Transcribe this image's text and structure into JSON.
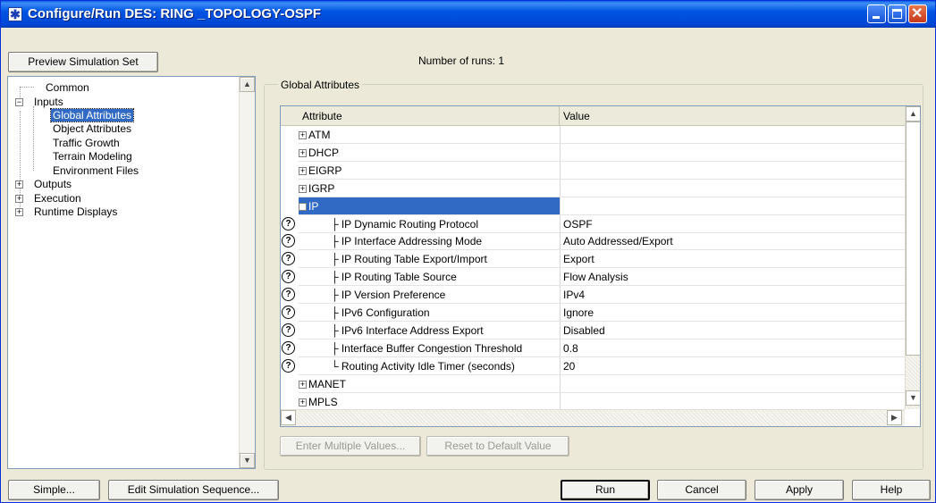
{
  "window": {
    "title": "Configure/Run DES: RING _TOPOLOGY-OSPF"
  },
  "toolbar": {
    "preview_label": "Preview Simulation Set",
    "runs_text": "Number of runs: 1"
  },
  "tree": {
    "items": [
      {
        "label": "Common"
      },
      {
        "label": "Inputs"
      },
      {
        "label": "Global Attributes"
      },
      {
        "label": "Object Attributes"
      },
      {
        "label": "Traffic Growth"
      },
      {
        "label": "Terrain Modeling"
      },
      {
        "label": "Environment Files"
      },
      {
        "label": "Outputs"
      },
      {
        "label": "Execution"
      },
      {
        "label": "Runtime Displays"
      }
    ]
  },
  "group": {
    "legend": "Global Attributes"
  },
  "grid": {
    "headers": [
      "Attribute",
      "Value"
    ],
    "rows": [
      {
        "attr": "ATM",
        "value": ""
      },
      {
        "attr": "DHCP",
        "value": ""
      },
      {
        "attr": "EIGRP",
        "value": ""
      },
      {
        "attr": "IGRP",
        "value": ""
      },
      {
        "attr": "IP",
        "value": ""
      },
      {
        "attr": "IP Dynamic Routing Protocol",
        "value": "OSPF"
      },
      {
        "attr": "IP Interface Addressing Mode",
        "value": "Auto Addressed/Export"
      },
      {
        "attr": "IP Routing Table Export/Import",
        "value": "Export"
      },
      {
        "attr": "IP Routing Table Source",
        "value": "Flow Analysis"
      },
      {
        "attr": "IP Version Preference",
        "value": "IPv4"
      },
      {
        "attr": "IPv6 Configuration",
        "value": "Ignore"
      },
      {
        "attr": "IPv6 Interface Address Export",
        "value": "Disabled"
      },
      {
        "attr": "Interface Buffer Congestion Threshold",
        "value": "0.8"
      },
      {
        "attr": "Routing Activity Idle Timer (seconds)",
        "value": "20"
      },
      {
        "attr": "MANET",
        "value": ""
      },
      {
        "attr": "MPLS",
        "value": ""
      }
    ]
  },
  "actions": {
    "enter_multiple": "Enter Multiple Values...",
    "reset_default": "Reset to Default Value"
  },
  "footer": {
    "simple": "Simple...",
    "edit_sequence": "Edit Simulation Sequence...",
    "run": "Run",
    "cancel": "Cancel",
    "apply": "Apply",
    "help": "Help"
  },
  "icons": {
    "app": "star-icon",
    "help": "question-icon"
  },
  "colors": {
    "title_bar": "#0054e3",
    "selection": "#316ac5",
    "dialog": "#ece9d8"
  }
}
